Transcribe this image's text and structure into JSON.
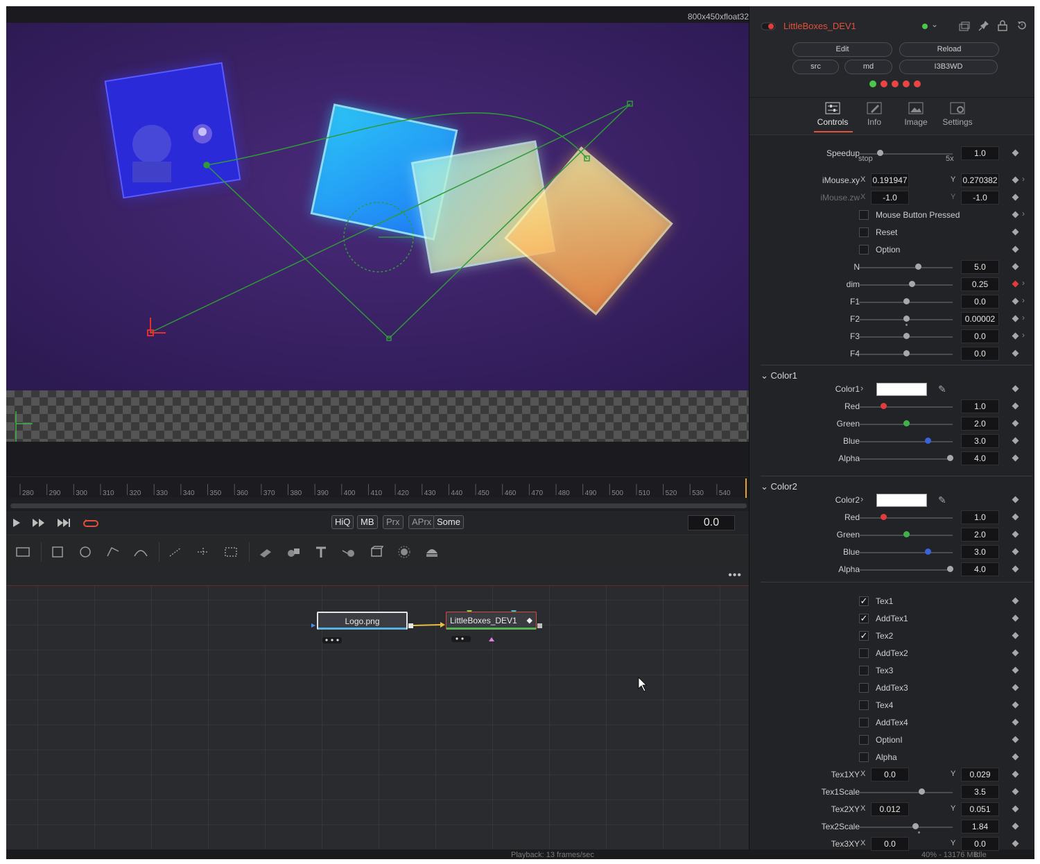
{
  "viewer": {
    "resolution": "800x450xfloat32",
    "ruler_ticks": [
      "280",
      "290",
      "300",
      "310",
      "320",
      "330",
      "340",
      "350",
      "360",
      "370",
      "380",
      "390",
      "400",
      "410",
      "420",
      "430",
      "440",
      "450",
      "460",
      "470",
      "480",
      "490",
      "500",
      "510",
      "520",
      "530",
      "540"
    ]
  },
  "transport": {
    "play_icon": "play-icon",
    "ff_icon": "fast-forward-icon",
    "end_icon": "skip-end-icon",
    "loop_icon": "loop-icon",
    "quality_buttons": [
      "HiQ",
      "MB",
      "Prx",
      "APrx",
      "Some"
    ],
    "current_time": "0.0"
  },
  "toolbar": {
    "tools": [
      "bg-tool-icon",
      "rectangle-mask-icon",
      "ellipse-mask-icon",
      "polygon-mask-icon",
      "bspline-mask-icon",
      "particle-emitter-icon",
      "particle-render-icon",
      "particle-style-icon",
      "image-plane-3d-icon",
      "shape-3d-icon",
      "text-3d-icon",
      "merge-3d-icon",
      "renderer-3d-icon",
      "camera-3d-icon",
      "light-3d-icon"
    ]
  },
  "flow": {
    "more_label": "•••",
    "nodes": [
      {
        "name": "Logo.png"
      },
      {
        "name": "LittleBoxes_DEV1"
      }
    ]
  },
  "statusbar": {
    "playback": "Playback: 13 frames/sec",
    "memory": "40% - 13176 MB",
    "state": "Idle"
  },
  "inspector": {
    "node_title": "LittleBoxes_DEV1",
    "buttons": {
      "edit": "Edit",
      "reload": "Reload",
      "src": "src",
      "md": "md",
      "id": "I3B3WD"
    },
    "dots": [
      "#4cc64c",
      "#e84545",
      "#e84545",
      "#e84545",
      "#e84545"
    ],
    "tabs": [
      "Controls",
      "Info",
      "Image",
      "Settings"
    ],
    "active_tab": "Controls",
    "speedup": {
      "label": "Speedup",
      "value": "1.0",
      "min_label": "stop",
      "max_label": "5x"
    },
    "imouse_xy": {
      "label": "iMouse.xy",
      "x_label": "X",
      "x": "0.191947",
      "y_label": "Y",
      "y": "0.270382"
    },
    "imouse_zw": {
      "label": "iMouse.zw",
      "x_label": "X",
      "x": "-1.0",
      "y_label": "Y",
      "y": "-1.0"
    },
    "checks_top": [
      {
        "label": "Mouse Button Pressed",
        "checked": false
      },
      {
        "label": "Reset",
        "checked": false
      },
      {
        "label": "Option",
        "checked": false
      }
    ],
    "sliders": [
      {
        "label": "N",
        "value": "5.0",
        "pos": 0.63
      },
      {
        "label": "dim",
        "value": "0.25",
        "pos": 0.56
      },
      {
        "label": "F1",
        "value": "0.0",
        "pos": 0.5
      },
      {
        "label": "F2",
        "value": "0.00002",
        "pos": 0.5
      },
      {
        "label": "F3",
        "value": "0.0",
        "pos": 0.5
      },
      {
        "label": "F4",
        "value": "0.0",
        "pos": 0.5
      }
    ],
    "color1": {
      "section": "Color1",
      "label": "Color1",
      "channels": [
        {
          "label": "Red",
          "value": "1.0",
          "pos": 0.26,
          "color": "#e23b3b"
        },
        {
          "label": "Green",
          "value": "2.0",
          "pos": 0.5,
          "color": "#3fb34a"
        },
        {
          "label": "Blue",
          "value": "3.0",
          "pos": 0.73,
          "color": "#3a62d9"
        },
        {
          "label": "Alpha",
          "value": "4.0",
          "pos": 0.97,
          "color": "#a8a8a8"
        }
      ]
    },
    "color2": {
      "section": "Color2",
      "label": "Color2",
      "channels": [
        {
          "label": "Red",
          "value": "1.0",
          "pos": 0.26,
          "color": "#e23b3b"
        },
        {
          "label": "Green",
          "value": "2.0",
          "pos": 0.5,
          "color": "#3fb34a"
        },
        {
          "label": "Blue",
          "value": "3.0",
          "pos": 0.73,
          "color": "#3a62d9"
        },
        {
          "label": "Alpha",
          "value": "4.0",
          "pos": 0.97,
          "color": "#a8a8a8"
        }
      ]
    },
    "tex_checks": [
      {
        "label": "Tex1",
        "checked": true
      },
      {
        "label": "AddTex1",
        "checked": true
      },
      {
        "label": "Tex2",
        "checked": true
      },
      {
        "label": "AddTex2",
        "checked": false
      },
      {
        "label": "Tex3",
        "checked": false
      },
      {
        "label": "AddTex3",
        "checked": false
      },
      {
        "label": "Tex4",
        "checked": false
      },
      {
        "label": "AddTex4",
        "checked": false
      },
      {
        "label": "OptionI",
        "checked": false
      },
      {
        "label": "Alpha",
        "checked": false
      }
    ],
    "tex1xy": {
      "label": "Tex1XY",
      "x_label": "X",
      "x": "0.0",
      "y_label": "Y",
      "y": "0.029"
    },
    "tex1scale": {
      "label": "Tex1Scale",
      "value": "3.5",
      "pos": 0.67
    },
    "tex2xy": {
      "label": "Tex2XY",
      "x_label": "X",
      "x": "0.012",
      "y_label": "Y",
      "y": "0.051"
    },
    "tex2scale": {
      "label": "Tex2Scale",
      "value": "1.84",
      "pos": 0.6
    },
    "tex3xy": {
      "label": "Tex3XY",
      "x_label": "X",
      "x": "0.0",
      "y_label": "Y",
      "y": "0.0"
    }
  }
}
